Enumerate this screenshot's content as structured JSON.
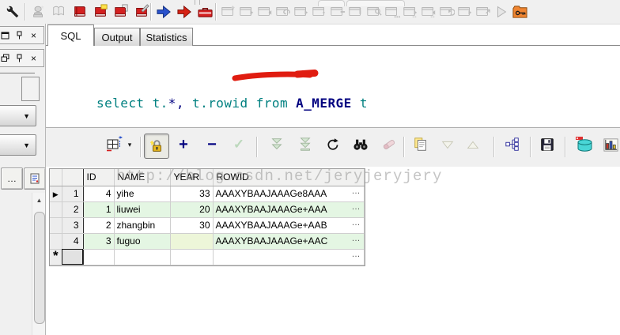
{
  "tabs": {
    "sql": "SQL",
    "output": "Output",
    "statistics": "Statistics"
  },
  "editor": {
    "sql_full": "select t.*, t.rowid from A_MERGE t",
    "tokens": [
      "select t.",
      "*",
      ", ",
      "t.",
      "rowid",
      " ",
      "from",
      " ",
      "A_MERGE",
      " t"
    ]
  },
  "watermark": "http://blog.csdn.net/jeryjeryjery",
  "grid": {
    "headers": [
      "ID",
      "NAME",
      "YEAR",
      "ROWID"
    ],
    "rows": [
      {
        "num": "1",
        "id": "4",
        "name": "yihe",
        "year": "33",
        "rowid": "AAAXYBAAJAAAGe8AAA"
      },
      {
        "num": "2",
        "id": "1",
        "name": "liuwei",
        "year": "20",
        "rowid": "AAAXYBAAJAAAGe+AAA"
      },
      {
        "num": "3",
        "id": "2",
        "name": "zhangbin",
        "year": "30",
        "rowid": "AAAXYBAAJAAAGe+AAB"
      },
      {
        "num": "4",
        "id": "3",
        "name": "fuguo",
        "year": "",
        "rowid": "AAAXYBAAJAAAGe+AAC"
      },
      {
        "num": "",
        "id": "",
        "name": "",
        "year": "",
        "rowid": ""
      }
    ]
  },
  "glyphs": {
    "dropdown": "▾",
    "combo_arrow": "▼",
    "scroll_up": "▲",
    "tri_down": "▼",
    "tri_up": "▲",
    "ellipsis": "…",
    "close": "×",
    "row_marker": "▶",
    "new_row": "*",
    "plus": "+",
    "minus": "−",
    "check": "✓"
  },
  "icons": {
    "top_toolbar": [
      "wrench-icon",
      "stamp-icon",
      "open-book-icon",
      "red-book-icon",
      "red-book-note-icon",
      "red-book-copy-icon",
      "red-book-brush-icon",
      "blue-arrow-icon",
      "red-arrow-icon",
      "toolbox-icon",
      "window-tool-icons-disabled",
      "play-icon",
      "folder-key-icon"
    ],
    "results_toolbar": [
      "grid-layout-icon",
      "edit-lock-icon",
      "add-record-icon",
      "delete-record-icon",
      "post-record-icon",
      "fetch-next-icon",
      "fetch-all-icon",
      "refresh-icon",
      "find-icon",
      "eraser-icon",
      "copy-results-icon",
      "scroll-down-icon",
      "scroll-up-icon",
      "sitemap-icon",
      "save-results-icon",
      "export-db-icon",
      "chart-icon",
      "report-grid-icon"
    ]
  },
  "colors": {
    "keyword_teal": "#008080",
    "symbol_navy": "#000080",
    "table_navy_bold": "#000080",
    "annotation_red": "#e01c10",
    "row_alt_green": "#e4f6e3",
    "grid_header_bg": "#f1f1f0",
    "toolbar_bg": "#f0f0f0"
  }
}
